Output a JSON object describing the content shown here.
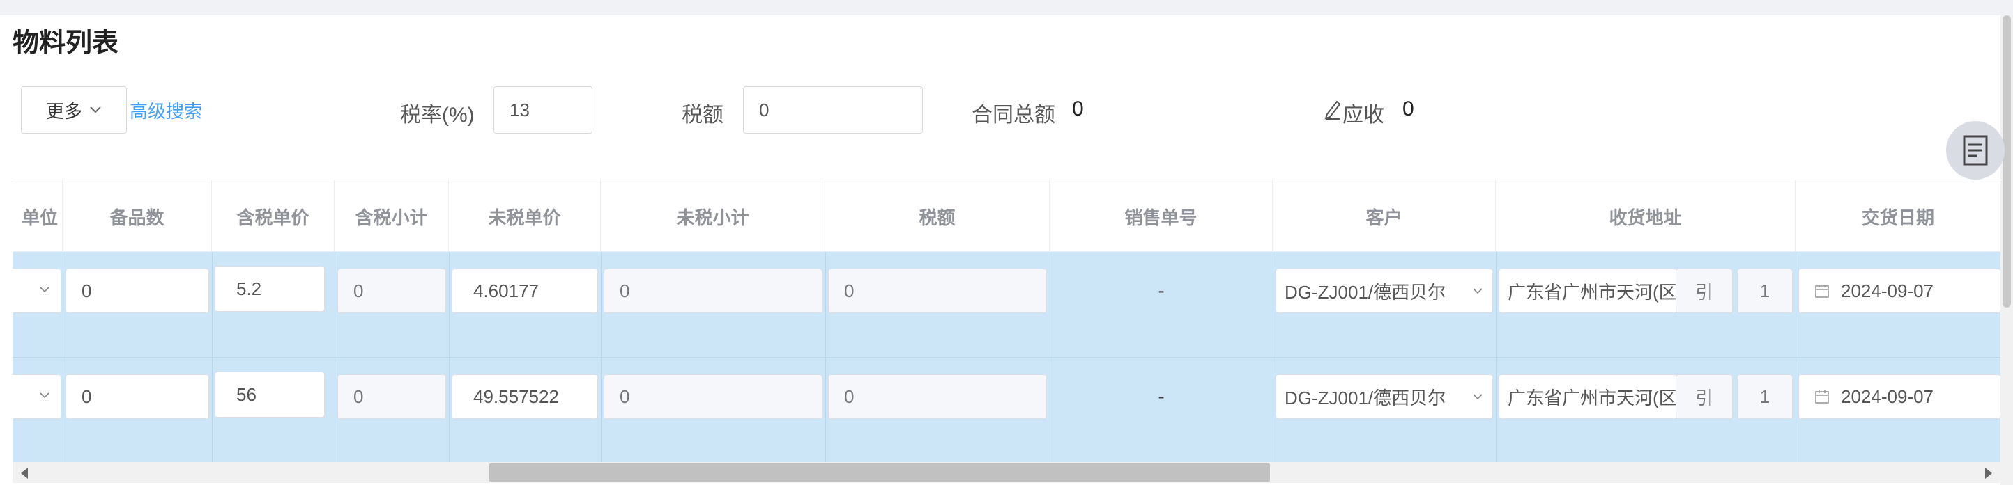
{
  "title": "物料列表",
  "toolbar": {
    "more_label": "更多",
    "advanced_search": "高级搜索",
    "tax_rate_label": "税率(%)",
    "tax_rate_value": "13",
    "tax_amount_label": "税额",
    "tax_amount_value": "0",
    "contract_total_label": "合同总额",
    "contract_total_value": "0",
    "receivable_label": "应收",
    "receivable_value": "0"
  },
  "table": {
    "headers": [
      "单位",
      "备品数",
      "含税单价",
      "含税小计",
      "未税单价",
      "未税小计",
      "税额",
      "销售单号",
      "客户",
      "收货地址",
      "交货日期"
    ],
    "rows": [
      {
        "spare_qty": "0",
        "unit_price_tax": "5.2",
        "subtotal_tax": "0",
        "unit_price_notax": "4.60177",
        "subtotal_notax": "0",
        "tax": "0",
        "sales_no": "-",
        "customer": "DG-ZJ001/德西贝尔",
        "address": "广东省广州市天河(区",
        "addr_btn": "引",
        "addr_num": "1",
        "delivery_date": "2024-09-07"
      },
      {
        "spare_qty": "0",
        "unit_price_tax": "56",
        "subtotal_tax": "0",
        "unit_price_notax": "49.557522",
        "subtotal_notax": "0",
        "tax": "0",
        "sales_no": "-",
        "customer": "DG-ZJ001/德西贝尔",
        "address": "广东省广州市天河(区",
        "addr_btn": "引",
        "addr_num": "1",
        "delivery_date": "2024-09-07"
      }
    ]
  },
  "icons": {
    "chevron": "chevron-down-icon",
    "edit": "edit-icon",
    "calendar": "calendar-icon",
    "doc": "document-icon"
  }
}
